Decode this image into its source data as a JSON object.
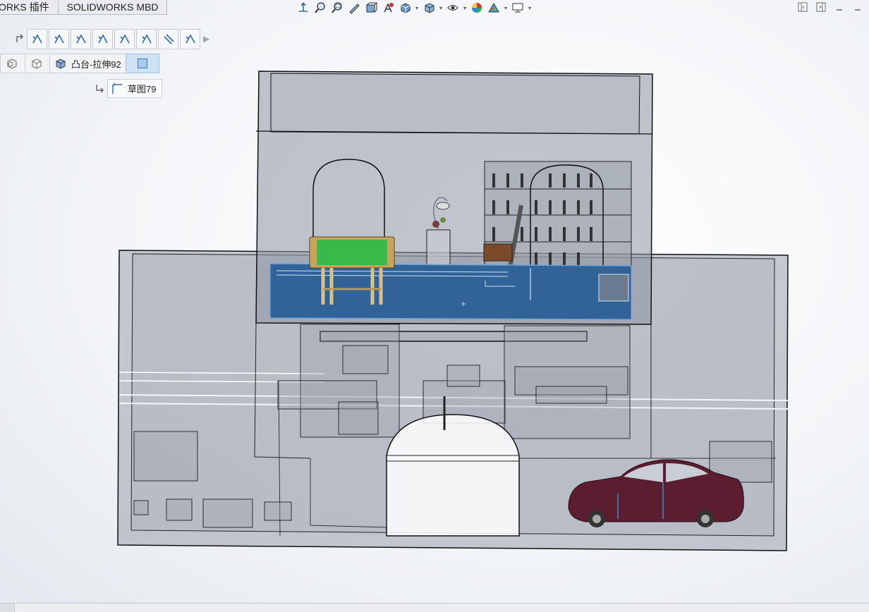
{
  "tabs": [
    "ORKS 插件",
    "SOLIDWORKS MBD"
  ],
  "headsup_icons": [
    "view-orientation-icon",
    "zoom-to-fit-icon",
    "zoom-area-icon",
    "previous-view-icon",
    "section-view-icon",
    "dynamic-annotation-icon",
    "view-orientation-cube-icon",
    "display-style-icon",
    "hide-show-icon",
    "edit-appearance-icon",
    "apply-scene-icon",
    "view-settings-icon"
  ],
  "snap_tools": [
    "snap-tool-1",
    "snap-tool-2",
    "snap-tool-3",
    "snap-tool-4",
    "snap-tool-5",
    "snap-tool-6",
    "snap-tool-parallel",
    "snap-tool-8"
  ],
  "breadcrumb": {
    "feature_label": "凸台-拉伸92",
    "sketch_label": "草图79"
  },
  "colors": {
    "floor_highlight": "#2a5a8f",
    "billiard_felt": "#39b94a",
    "car_body": "#5b1e30",
    "wall_glass": "#8e96a3"
  }
}
